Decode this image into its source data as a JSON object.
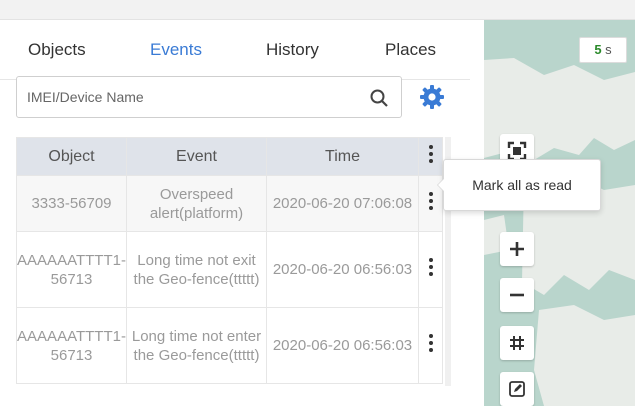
{
  "tabs": [
    {
      "label": "Objects"
    },
    {
      "label": "Events"
    },
    {
      "label": "History"
    },
    {
      "label": "Places"
    }
  ],
  "active_tab": "Events",
  "search": {
    "placeholder": "IMEI/Device Name",
    "icon": "search-icon"
  },
  "settings_icon": "gear-icon",
  "table": {
    "columns": [
      "Object",
      "Event",
      "Time"
    ],
    "rows": [
      {
        "object": "3333-56709",
        "event": "Overspeed alert(platform)",
        "time": "2020-06-20 07:06:08"
      },
      {
        "object": "AAAAAATTTT1-56713",
        "event": "Long time not exit the Geo-fence(ttttt)",
        "time": "2020-06-20 06:56:03"
      },
      {
        "object": "AAAAAATTTT1-56713",
        "event": "Long time not enter the Geo-fence(ttttt)",
        "time": "2020-06-20 06:56:03"
      }
    ]
  },
  "tooltip": {
    "text": "Mark all as read"
  },
  "map": {
    "timer_value": "5",
    "timer_unit": "s",
    "tools": [
      "fit-screen-icon",
      "zoom-in-icon",
      "zoom-out-icon",
      "grid-icon",
      "edit-icon"
    ]
  },
  "colors": {
    "accent": "#3a7bd5",
    "header_bg": "#dfe3ea",
    "map_water": "#b9d5cc",
    "map_land": "#e8ece8"
  }
}
